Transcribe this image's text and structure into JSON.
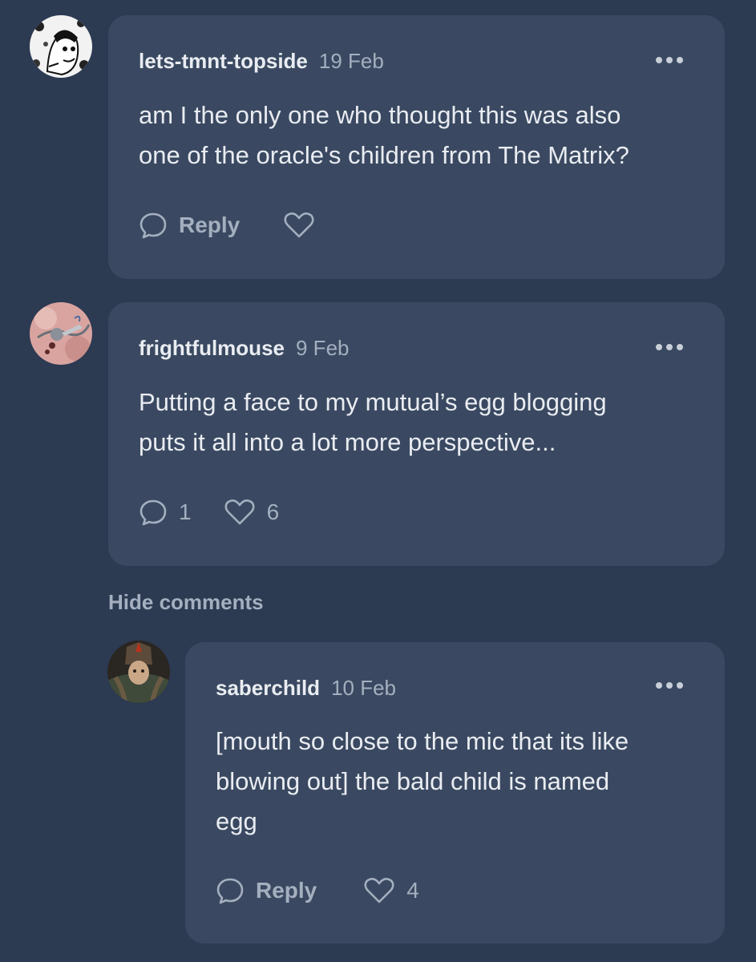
{
  "comments": [
    {
      "username": "lets-tmnt-topside",
      "date": "19 Feb",
      "text": "am I the only one who thought this was also\none of the oracle's children from The Matrix?",
      "reply_label": "Reply",
      "reply_count": "",
      "like_count": "",
      "avatar_icon": "bw-illustrated-avatar"
    },
    {
      "username": "frightfulmouse",
      "date": "9 Feb",
      "text": "Putting a face to my mutual’s egg blogging\nputs it all into a lot more perspective...",
      "reply_label": "",
      "reply_count": "1",
      "like_count": "6",
      "avatar_icon": "pink-illustrated-avatar"
    }
  ],
  "hide_comments_label": "Hide comments",
  "replies": [
    {
      "username": "saberchild",
      "date": "10 Feb",
      "text": "[mouth so close to the mic that its like\nblowing out] the bald child is named\negg",
      "reply_label": "Reply",
      "like_count": "4",
      "avatar_icon": "armored-character-avatar"
    }
  ],
  "colors": {
    "background": "#2c3a52",
    "card": "#3a4961",
    "text": "#e9ecf1",
    "muted": "#a4afbf"
  }
}
